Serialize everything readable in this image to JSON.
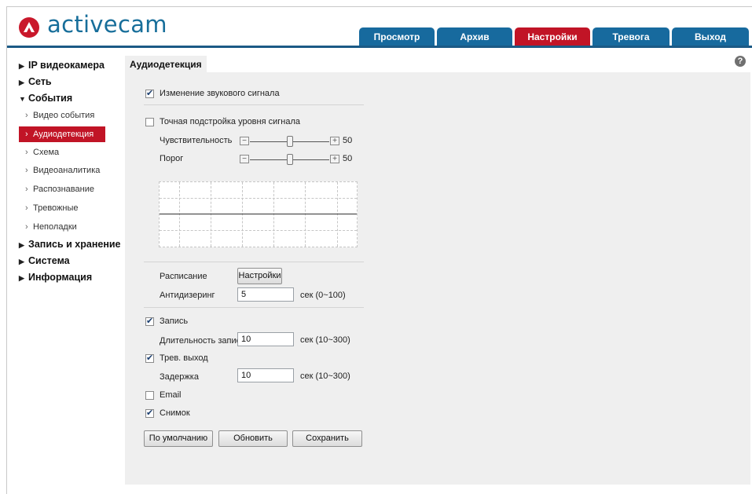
{
  "brand": {
    "name": "activecam"
  },
  "tabs": [
    {
      "label": "Просмотр"
    },
    {
      "label": "Архив"
    },
    {
      "label": "Настройки"
    },
    {
      "label": "Тревога"
    },
    {
      "label": "Выход"
    }
  ],
  "sidebar": {
    "ip_camera": "IP видеокамера",
    "network": "Сеть",
    "events": "События",
    "events_items": [
      "Видео события",
      "Аудиодетекция",
      "Схема",
      "Видеоаналитика",
      "Распознавание",
      "Тревожные",
      "Неполадки"
    ],
    "recording": "Запись и хранение",
    "system": "Система",
    "info": "Информация"
  },
  "page": {
    "title": "Аудиодетекция",
    "help": "?",
    "audio_change_label": "Изменение звукового сигнала",
    "fine_tune_label": "Точная подстройка уровня сигнала",
    "sensitivity_label": "Чувствительность",
    "sensitivity_value": "50",
    "threshold_label": "Порог",
    "threshold_value": "50",
    "schedule_label": "Расписание",
    "schedule_button": "Настройки",
    "antijitter_label": "Антидизеринг",
    "antijitter_value": "5",
    "antijitter_unit": "сек (0~100)",
    "record_label": "Запись",
    "record_duration_label": "Длительность записи",
    "record_duration_value": "10",
    "record_duration_unit": "сек (10~300)",
    "alarm_out_label": "Трев. выход",
    "delay_label": "Задержка",
    "delay_value": "10",
    "delay_unit": "сек (10~300)",
    "email_label": "Email",
    "snapshot_label": "Снимок",
    "btn_default": "По умолчанию",
    "btn_refresh": "Обновить",
    "btn_save": "Сохранить"
  },
  "state": {
    "audio_change_checked": true,
    "fine_tune_checked": false,
    "record_checked": true,
    "alarm_out_checked": true,
    "email_checked": false,
    "snapshot_checked": true
  },
  "colors": {
    "brand_red": "#c11426",
    "tab_blue": "#176a9e",
    "logo_blue": "#176e9a"
  }
}
